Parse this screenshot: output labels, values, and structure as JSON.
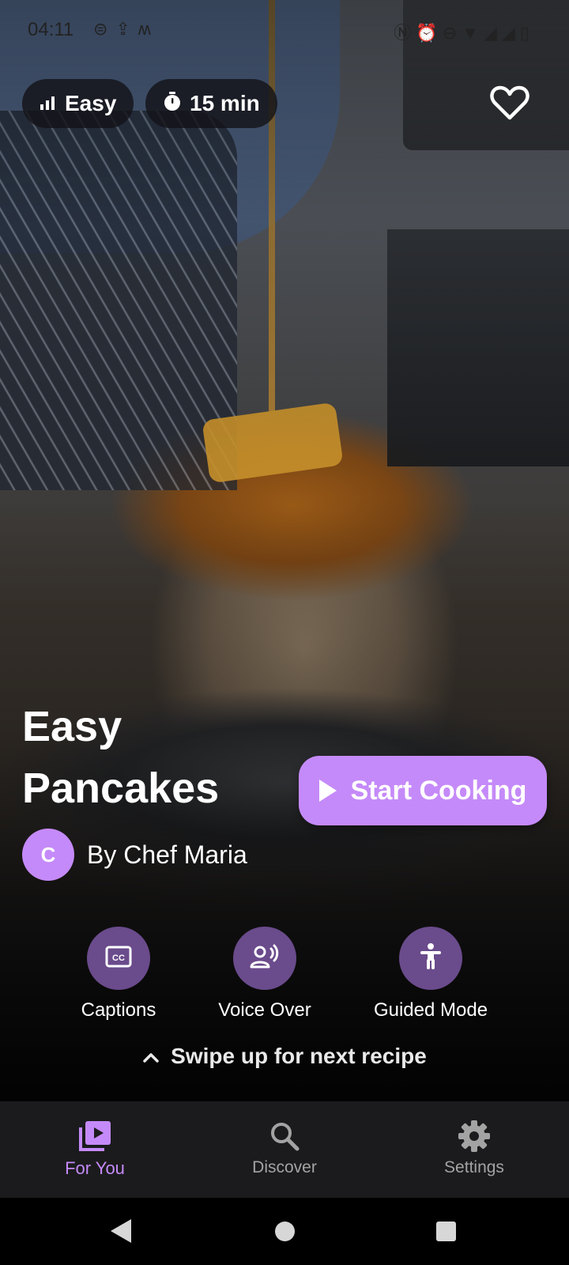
{
  "status_bar": {
    "time": "04:11",
    "left_icons": [
      "sim-icon",
      "upload-icon",
      "wave-icon"
    ],
    "right_icons": [
      "nfc-icon",
      "alarm-icon",
      "sync-icon",
      "wifi-icon",
      "signal-icon",
      "signal-icon",
      "battery-icon"
    ]
  },
  "recipe": {
    "difficulty": "Easy",
    "time": "15 min",
    "title": "Easy Pancakes",
    "author_initial": "C",
    "author": "By Chef Maria",
    "favorited": false
  },
  "actions": {
    "start_cooking": "Start Cooking"
  },
  "options": [
    {
      "label": "Captions",
      "icon": "closed-captions-icon"
    },
    {
      "label": "Voice Over",
      "icon": "voice-over-icon"
    },
    {
      "label": "Guided Mode",
      "icon": "accessibility-icon"
    }
  ],
  "swipe_hint": "Swipe up for next recipe",
  "bottom_nav": [
    {
      "label": "For You",
      "icon": "video-library-icon",
      "active": true
    },
    {
      "label": "Discover",
      "icon": "search-icon",
      "active": false
    },
    {
      "label": "Settings",
      "icon": "gear-icon",
      "active": false
    }
  ],
  "colors": {
    "accent": "#c58af9",
    "option_circle": "#6a4b8c",
    "nav_background": "#1b1b1d"
  }
}
